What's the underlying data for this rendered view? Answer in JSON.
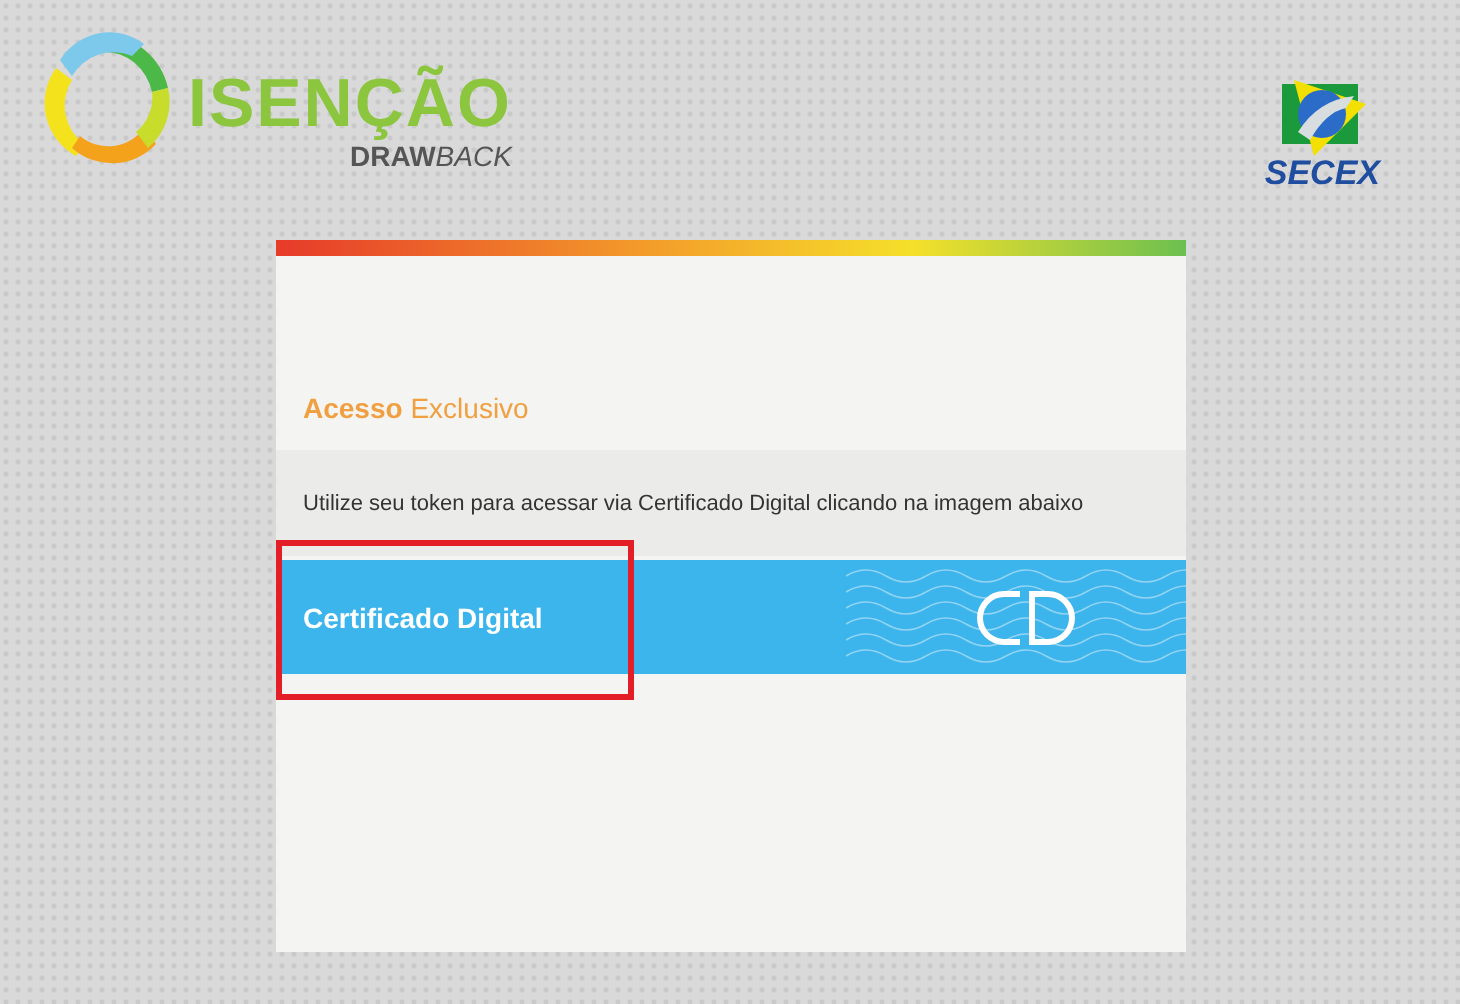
{
  "header": {
    "brand_title": "ISENÇÃO",
    "brand_subtitle": "**DRAW**BACK",
    "agency": "SECEX"
  },
  "card": {
    "heading_strong": "Acesso",
    "heading_rest": "Exclusivo",
    "instruction": "Utilize seu token para acessar via Certificado Digital clicando na imagem abaixo",
    "certificate_button": {
      "label": "Certificado Digital",
      "highlighted": true
    }
  }
}
